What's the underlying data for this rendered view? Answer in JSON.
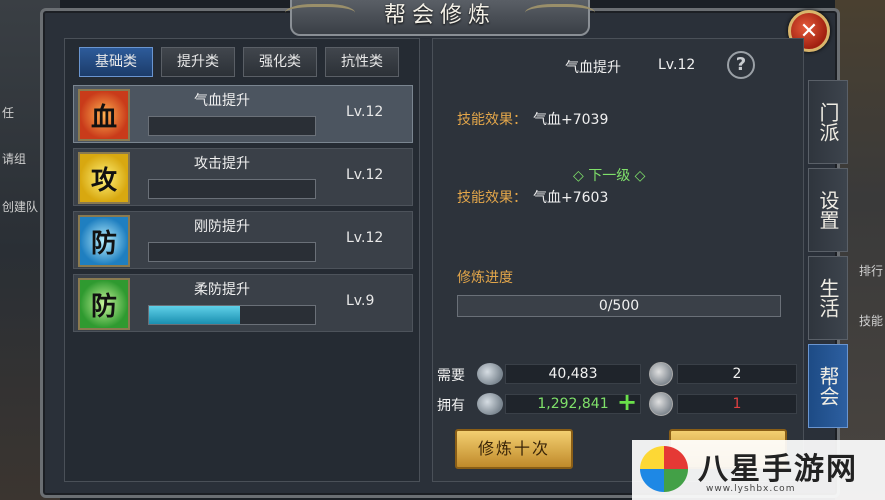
{
  "window": {
    "title": "帮会修炼"
  },
  "tabs": [
    {
      "label": "基础类",
      "active": true
    },
    {
      "label": "提升类",
      "active": false
    },
    {
      "label": "强化类",
      "active": false
    },
    {
      "label": "抗性类",
      "active": false
    }
  ],
  "skills": [
    {
      "icon_char": "血",
      "icon": "blood-icon",
      "name": "气血提升",
      "level": "Lv.12",
      "progress": 0,
      "color": "#c93b1a",
      "selected": true
    },
    {
      "icon_char": "攻",
      "icon": "attack-icon",
      "name": "攻击提升",
      "level": "Lv.12",
      "progress": 0,
      "color": "#e0c020",
      "selected": false
    },
    {
      "icon_char": "防",
      "icon": "defense-icon",
      "name": "刚防提升",
      "level": "Lv.12",
      "progress": 0,
      "color": "#2a90d0",
      "selected": false
    },
    {
      "icon_char": "防",
      "icon": "soft-defense-icon",
      "name": "柔防提升",
      "level": "Lv.9",
      "progress": 0.55,
      "color": "#3ca83a",
      "selected": false
    }
  ],
  "detail": {
    "name": "气血提升",
    "level": "Lv.12",
    "help": "?",
    "current_effect_label": "技能效果：",
    "current_effect_value": "气血+7039",
    "next_label": "下一级",
    "next_effect_label": "技能效果：",
    "next_effect_value": "气血+7603",
    "progress_label": "修炼进度",
    "progress_text": "0/500"
  },
  "resources": {
    "need_label": "需要",
    "need_silver": "40,483",
    "need_item": "2",
    "have_label": "拥有",
    "have_silver": "1,292,841",
    "have_item": "1",
    "add": "+"
  },
  "actions": {
    "train_ten": "修炼十次"
  },
  "close": "✕",
  "side_tabs": [
    {
      "label": "门派",
      "active": false
    },
    {
      "label": "设置",
      "active": false
    },
    {
      "label": "生活",
      "active": false
    },
    {
      "label": "帮会",
      "active": true
    }
  ],
  "background": {
    "left_texts": [
      "任",
      "请组",
      "创建队"
    ],
    "right_texts": [
      "排行",
      "技能"
    ]
  },
  "watermark": {
    "text": "八星手游网",
    "url": "www.lyshbx.com"
  },
  "colors": {
    "effect_label": "#e3a64a",
    "next_level": "#7fe06a",
    "have_silver": "#7fe06a",
    "have_item": "#e04040"
  }
}
